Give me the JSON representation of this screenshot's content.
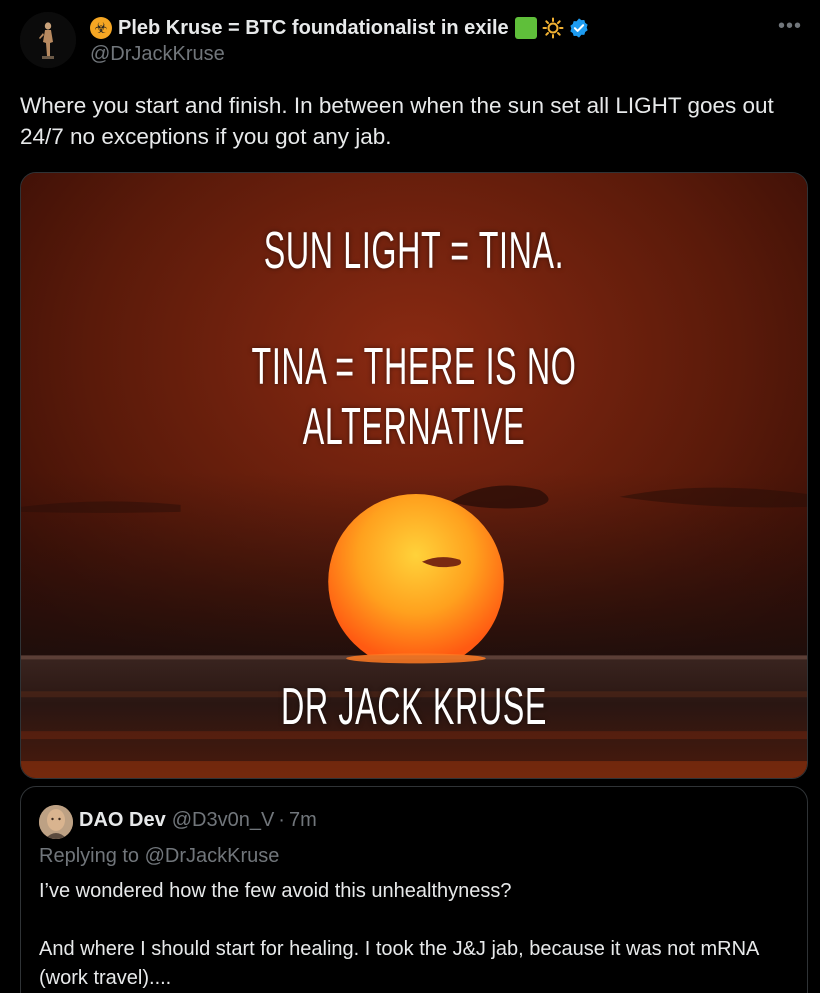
{
  "author": {
    "display_name": "Pleb Kruse = BTC foundationalist in exile",
    "handle": "@DrJackKruse",
    "icons": [
      "biohazard-icon",
      "green-square-icon",
      "sun-icon",
      "verified-icon"
    ]
  },
  "tweet": {
    "text": "Where you start and finish.  In between when the sun set all LIGHT goes out 24/7 no exceptions if you got any jab."
  },
  "media": {
    "line1": "SUN LIGHT = TINA.",
    "line2": "TINA = THERE IS NO ALTERNATIVE",
    "line3": "DR JACK KRUSE"
  },
  "quoted": {
    "name": "DAO Dev",
    "handle": "@D3v0n_V",
    "separator": "·",
    "time": "7m",
    "replying_prefix": "Replying to ",
    "replying_to": "@DrJackKruse",
    "text": "I’ve wondered how the few avoid this unhealthyness?\n\nAnd where I should start for healing. I took the J&J jab, because it was not mRNA (work travel)...."
  },
  "colors": {
    "background": "#000000",
    "text": "#e7e9ea",
    "secondary": "#71767b",
    "border": "#2f3336",
    "verified": "#1d9bf0"
  }
}
